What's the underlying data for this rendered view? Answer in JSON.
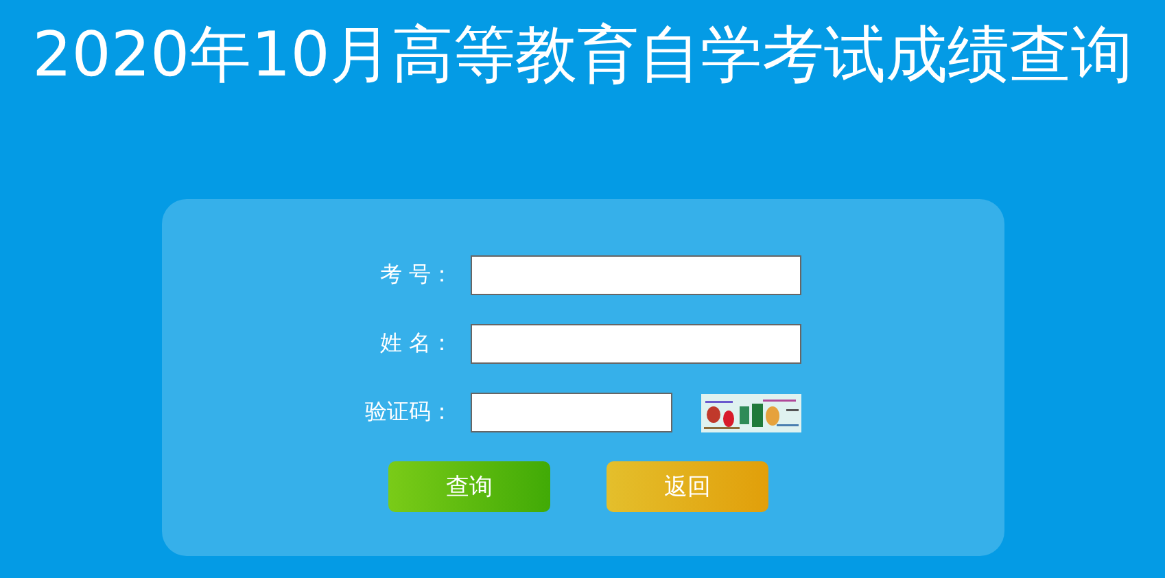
{
  "title": "2020年10月高等教育自学考试成绩查询",
  "form": {
    "fields": [
      {
        "label": "考 号：",
        "kind": "text"
      },
      {
        "label": "姓 名：",
        "kind": "text"
      },
      {
        "label": "验证码：",
        "kind": "captcha"
      }
    ],
    "buttons": [
      {
        "label": "查询",
        "kind": "primary"
      },
      {
        "label": "返回",
        "kind": "secondary"
      }
    ]
  }
}
